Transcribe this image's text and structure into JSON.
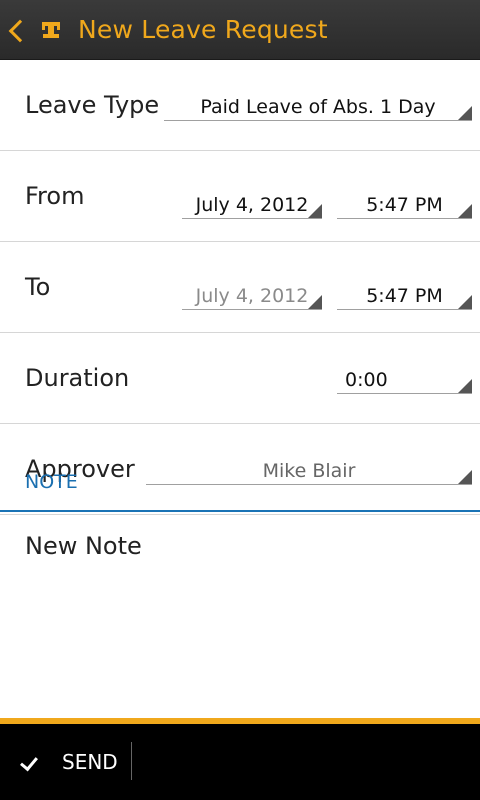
{
  "action_bar": {
    "title": "New Leave Request",
    "back_icon": "chevron-left-icon",
    "app_icon": "app-logo-icon",
    "accent_color": "#f0a81c"
  },
  "form": {
    "leave_type": {
      "label": "Leave Type",
      "value": "Paid Leave of Abs. 1 Day"
    },
    "from": {
      "label": "From",
      "date": "July 4, 2012",
      "time": "5:47 PM"
    },
    "to": {
      "label": "To",
      "date": "July 4, 2012",
      "time": "5:47 PM"
    },
    "duration": {
      "label": "Duration",
      "value": "0:00"
    },
    "approver": {
      "label": "Approver",
      "value": "Mike Blair"
    }
  },
  "note": {
    "header": "NOTE",
    "placeholder": "New Note"
  },
  "bottom_bar": {
    "send_label": "SEND",
    "send_icon": "checkmark-icon"
  }
}
